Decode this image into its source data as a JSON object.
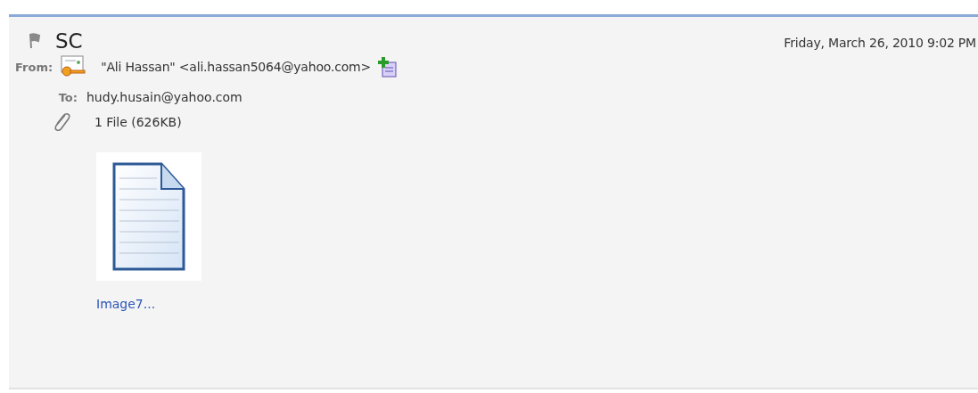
{
  "message": {
    "subject": "SC",
    "date": "Friday, March 26, 2010 9:02 PM",
    "from_label": "From:",
    "from": "\"Ali Hassan\" <ali.hassan5064@yahoo.com>",
    "to_label": "To:",
    "to": "hudy.husain@yahoo.com",
    "attachment_summary": "1 File (626KB)",
    "attachments": [
      {
        "name": "Image7..."
      }
    ]
  }
}
